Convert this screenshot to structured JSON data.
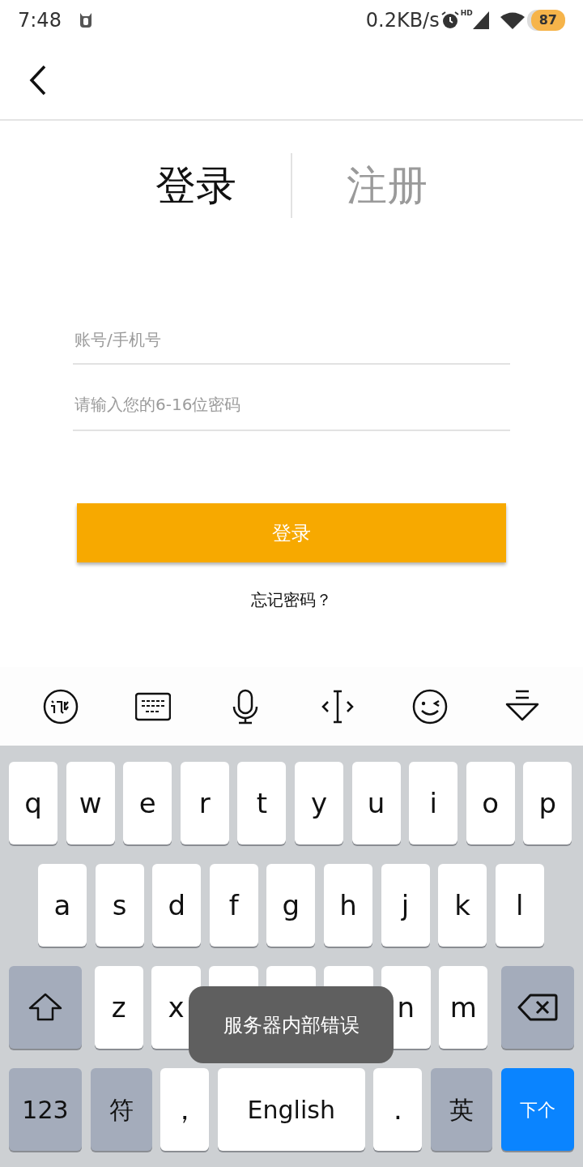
{
  "status_bar": {
    "time": "7:48",
    "net_speed": "0.2KB/s",
    "hd_label": "HD",
    "battery": "87"
  },
  "tabs": [
    {
      "label": "登录",
      "selected": true
    },
    {
      "label": "注册",
      "selected": false
    }
  ],
  "fields": [
    {
      "placeholder": "账号/手机号"
    },
    {
      "placeholder": "请输入您的6-16位密码"
    }
  ],
  "login_button": "登录",
  "forgot_link": "忘记密码？",
  "keyboard": {
    "rows": [
      {
        "keys": [
          {
            "label": "q",
            "kind": "letter"
          },
          {
            "label": "w",
            "kind": "letter"
          },
          {
            "label": "e",
            "kind": "letter"
          },
          {
            "label": "r",
            "kind": "letter"
          },
          {
            "label": "t",
            "kind": "letter"
          },
          {
            "label": "y",
            "kind": "letter"
          },
          {
            "label": "u",
            "kind": "letter"
          },
          {
            "label": "i",
            "kind": "letter"
          },
          {
            "label": "o",
            "kind": "letter"
          },
          {
            "label": "p",
            "kind": "letter"
          }
        ]
      },
      {
        "keys": [
          {
            "label": "a",
            "kind": "letter"
          },
          {
            "label": "s",
            "kind": "letter"
          },
          {
            "label": "d",
            "kind": "letter"
          },
          {
            "label": "f",
            "kind": "letter"
          },
          {
            "label": "g",
            "kind": "letter"
          },
          {
            "label": "h",
            "kind": "letter"
          },
          {
            "label": "j",
            "kind": "letter"
          },
          {
            "label": "k",
            "kind": "letter"
          },
          {
            "label": "l",
            "kind": "letter"
          }
        ]
      },
      {
        "keys": [
          {
            "kind": "shift"
          },
          {
            "label": "z",
            "kind": "letter"
          },
          {
            "label": "x",
            "kind": "letter"
          },
          {
            "kind": "covered"
          },
          {
            "kind": "covered"
          },
          {
            "kind": "covered"
          },
          {
            "label": "n",
            "kind": "letter"
          },
          {
            "label": "m",
            "kind": "letter"
          },
          {
            "kind": "backspace"
          }
        ]
      },
      {
        "keys": [
          {
            "label": "123",
            "kind": "mode"
          },
          {
            "label": "符",
            "kind": "symbol"
          },
          {
            "label": "，",
            "kind": "letter"
          },
          {
            "label": "English",
            "kind": "space"
          },
          {
            "label": ".",
            "kind": "letter"
          },
          {
            "label": "英",
            "kind": "symbol"
          },
          {
            "label": "下个",
            "kind": "next"
          }
        ]
      }
    ]
  },
  "toast": "服务器内部错误"
}
